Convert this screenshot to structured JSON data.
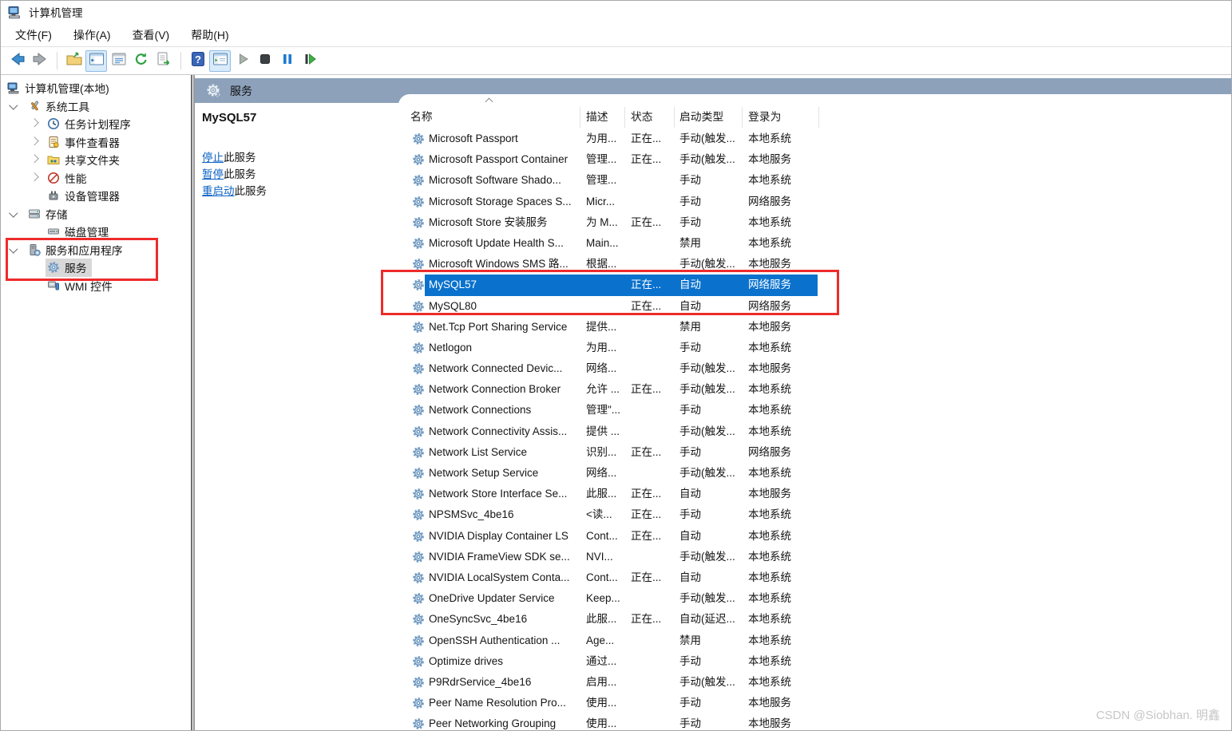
{
  "window": {
    "title": "计算机管理"
  },
  "menu": {
    "items": [
      {
        "name": "file",
        "label": "文件(F)"
      },
      {
        "name": "action",
        "label": "操作(A)"
      },
      {
        "name": "view",
        "label": "查看(V)"
      },
      {
        "name": "help",
        "label": "帮助(H)"
      }
    ]
  },
  "toolbar": {
    "buttons": [
      {
        "name": "back",
        "icon": "back-arrow-icon"
      },
      {
        "name": "forward",
        "icon": "forward-arrow-icon"
      },
      {
        "separator": true
      },
      {
        "name": "export-folder",
        "icon": "folder-arrow-icon"
      },
      {
        "name": "show-hide-console-tree",
        "icon": "window-tree-icon",
        "active": true
      },
      {
        "name": "properties",
        "icon": "properties-icon"
      },
      {
        "name": "refresh",
        "icon": "refresh-icon"
      },
      {
        "name": "export-list",
        "icon": "export-list-icon"
      },
      {
        "separator": true
      },
      {
        "name": "help",
        "icon": "help-icon"
      },
      {
        "name": "show-hide-action-pane",
        "icon": "window-action-icon",
        "active": true
      },
      {
        "name": "start-service",
        "icon": "play-icon"
      },
      {
        "name": "stop-service",
        "icon": "stop-icon"
      },
      {
        "name": "pause-service",
        "icon": "pause-icon"
      },
      {
        "name": "restart-service",
        "icon": "restart-icon"
      }
    ]
  },
  "tree": {
    "items": [
      {
        "name": "computer-management-local",
        "label": "计算机管理(本地)",
        "level": 0,
        "icon": "computer",
        "expander": ""
      },
      {
        "name": "system-tools",
        "label": "系统工具",
        "level": 1,
        "icon": "tools",
        "expander": "down"
      },
      {
        "name": "task-scheduler",
        "label": "任务计划程序",
        "level": 2,
        "icon": "scheduler",
        "expander": "right"
      },
      {
        "name": "event-viewer",
        "label": "事件查看器",
        "level": 2,
        "icon": "eventviewer",
        "expander": "right"
      },
      {
        "name": "shared-folders",
        "label": "共享文件夹",
        "level": 2,
        "icon": "sharedfolder",
        "expander": "right"
      },
      {
        "name": "performance",
        "label": "性能",
        "level": 2,
        "icon": "performance",
        "expander": "right"
      },
      {
        "name": "device-manager",
        "label": "设备管理器",
        "level": 2,
        "icon": "devicemgr",
        "expander": ""
      },
      {
        "name": "storage",
        "label": "存储",
        "level": 1,
        "icon": "storage",
        "expander": "down"
      },
      {
        "name": "disk-management",
        "label": "磁盘管理",
        "level": 2,
        "icon": "disk",
        "expander": ""
      },
      {
        "name": "services-and-applications",
        "label": "服务和应用程序",
        "level": 1,
        "icon": "svcapps",
        "expander": "down"
      },
      {
        "name": "services",
        "label": "服务",
        "level": 2,
        "icon": "gear",
        "expander": "",
        "selected": true
      },
      {
        "name": "wmi-control",
        "label": "WMI 控件",
        "level": 2,
        "icon": "wmi",
        "expander": ""
      }
    ]
  },
  "panel": {
    "header": "服务",
    "selected_service": "MySQL57",
    "links": [
      {
        "name": "stop-service-link",
        "action": "停止",
        "suffix": "此服务"
      },
      {
        "name": "pause-service-link",
        "action": "暂停",
        "suffix": "此服务"
      },
      {
        "name": "restart-service-link",
        "action": "重启动",
        "suffix": "此服务"
      }
    ]
  },
  "services_table": {
    "columns": [
      "名称",
      "描述",
      "状态",
      "启动类型",
      "登录为"
    ],
    "selected_row": "MySQL57",
    "rows": [
      [
        "Microsoft Passport",
        "为用...",
        "正在...",
        "手动(触发...",
        "本地系统"
      ],
      [
        "Microsoft Passport Container",
        "管理...",
        "正在...",
        "手动(触发...",
        "本地服务"
      ],
      [
        "Microsoft Software Shado...",
        "管理...",
        "",
        "手动",
        "本地系统"
      ],
      [
        "Microsoft Storage Spaces S...",
        "Micr...",
        "",
        "手动",
        "网络服务"
      ],
      [
        "Microsoft Store 安装服务",
        "为 M...",
        "正在...",
        "手动",
        "本地系统"
      ],
      [
        "Microsoft Update Health S...",
        "Main...",
        "",
        "禁用",
        "本地系统"
      ],
      [
        "Microsoft Windows SMS 路...",
        "根据...",
        "",
        "手动(触发...",
        "本地服务"
      ],
      [
        "MySQL57",
        "",
        "正在...",
        "自动",
        "网络服务"
      ],
      [
        "MySQL80",
        "",
        "正在...",
        "自动",
        "网络服务"
      ],
      [
        "Net.Tcp Port Sharing Service",
        "提供...",
        "",
        "禁用",
        "本地服务"
      ],
      [
        "Netlogon",
        "为用...",
        "",
        "手动",
        "本地系统"
      ],
      [
        "Network Connected Devic...",
        "网络...",
        "",
        "手动(触发...",
        "本地服务"
      ],
      [
        "Network Connection Broker",
        "允许 ...",
        "正在...",
        "手动(触发...",
        "本地系统"
      ],
      [
        "Network Connections",
        "管理\"...",
        "",
        "手动",
        "本地系统"
      ],
      [
        "Network Connectivity Assis...",
        "提供 ...",
        "",
        "手动(触发...",
        "本地系统"
      ],
      [
        "Network List Service",
        "识别...",
        "正在...",
        "手动",
        "网络服务"
      ],
      [
        "Network Setup Service",
        "网络...",
        "",
        "手动(触发...",
        "本地系统"
      ],
      [
        "Network Store Interface Se...",
        "此服...",
        "正在...",
        "自动",
        "本地服务"
      ],
      [
        "NPSMSvc_4be16",
        "<读...",
        "正在...",
        "手动",
        "本地系统"
      ],
      [
        "NVIDIA Display Container LS",
        "Cont...",
        "正在...",
        "自动",
        "本地系统"
      ],
      [
        "NVIDIA FrameView SDK se...",
        "NVI...",
        "",
        "手动(触发...",
        "本地系统"
      ],
      [
        "NVIDIA LocalSystem Conta...",
        "Cont...",
        "正在...",
        "自动",
        "本地系统"
      ],
      [
        "OneDrive Updater Service",
        "Keep...",
        "",
        "手动(触发...",
        "本地系统"
      ],
      [
        "OneSyncSvc_4be16",
        "此服...",
        "正在...",
        "自动(延迟...",
        "本地系统"
      ],
      [
        "OpenSSH Authentication ...",
        "Age...",
        "",
        "禁用",
        "本地系统"
      ],
      [
        "Optimize drives",
        "通过...",
        "",
        "手动",
        "本地系统"
      ],
      [
        "P9RdrService_4be16",
        "启用...",
        "",
        "手动(触发...",
        "本地系统"
      ],
      [
        "Peer Name Resolution Pro...",
        "使用...",
        "",
        "手动",
        "本地服务"
      ],
      [
        "Peer Networking Grouping",
        "使用...",
        "",
        "手动",
        "本地服务"
      ]
    ]
  },
  "annotations": {
    "tree_box": "services-node-highlight",
    "rows_box": "mysql-rows-highlight",
    "color": "#ee2b2b"
  },
  "colors": {
    "selection_blue": "#0a72cd",
    "band_blue_gray": "#8da1bb",
    "link_blue": "#0b62c4",
    "tree_selection_gray": "#d8d8d8",
    "watermark_gray": "#c6c6c6"
  },
  "watermark": "CSDN @Siobhan. 明鑫"
}
